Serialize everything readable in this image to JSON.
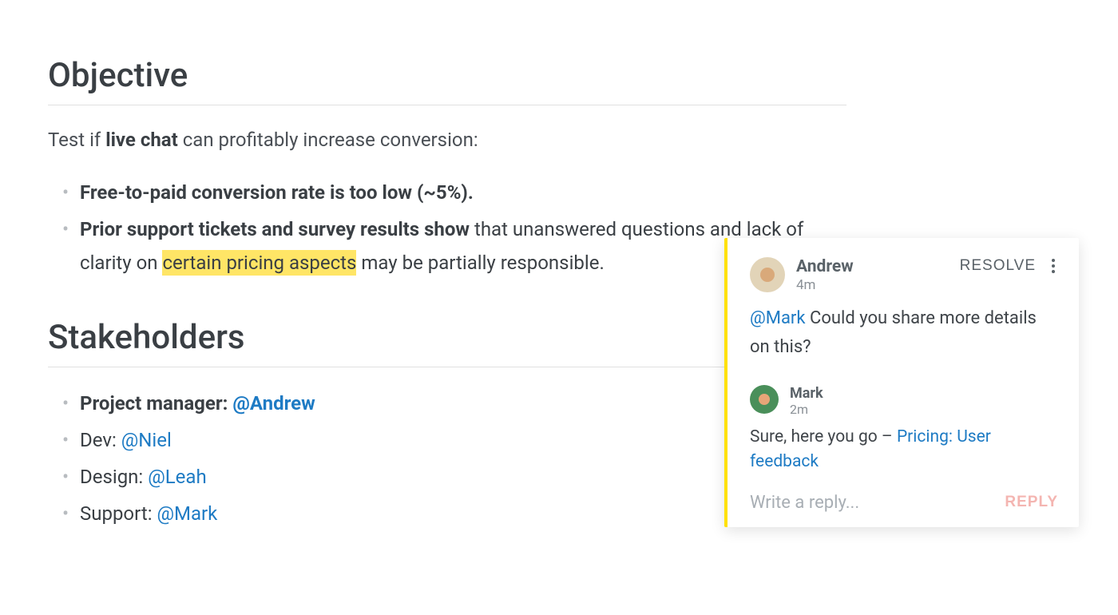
{
  "section1": {
    "heading": "Objective",
    "intro_pre": "Test if ",
    "intro_bold": "live chat",
    "intro_post": " can profitably increase conversion:",
    "bullets": [
      {
        "bold": "Free-to-paid conversion rate is too low (~5%).",
        "tail_pre": "",
        "highlight": "",
        "tail_post": ""
      },
      {
        "bold": "Prior support tickets and survey results show",
        "tail_pre": " that unanswered questions and lack of clarity on ",
        "highlight": "certain pricing aspects",
        "tail_post": " may be partially responsible."
      }
    ]
  },
  "section2": {
    "heading": "Stakeholders",
    "items": [
      {
        "role": "Project manager:",
        "mention": "@Andrew"
      },
      {
        "role": "Dev:",
        "mention": "@Niel"
      },
      {
        "role": "Design:",
        "mention": "@Leah"
      },
      {
        "role": "Support:",
        "mention": "@Mark"
      }
    ]
  },
  "commentCard": {
    "author": "Andrew",
    "time": "4m",
    "resolve_label": "RESOLVE",
    "body_mention": "@Mark",
    "body_text": " Could you share more details on this?",
    "reply": {
      "author": "Mark",
      "time": "2m",
      "text_pre": "Sure, here you go – ",
      "link": "Pricing: User feedback"
    },
    "input_placeholder": "Write a reply...",
    "reply_label": "REPLY"
  }
}
